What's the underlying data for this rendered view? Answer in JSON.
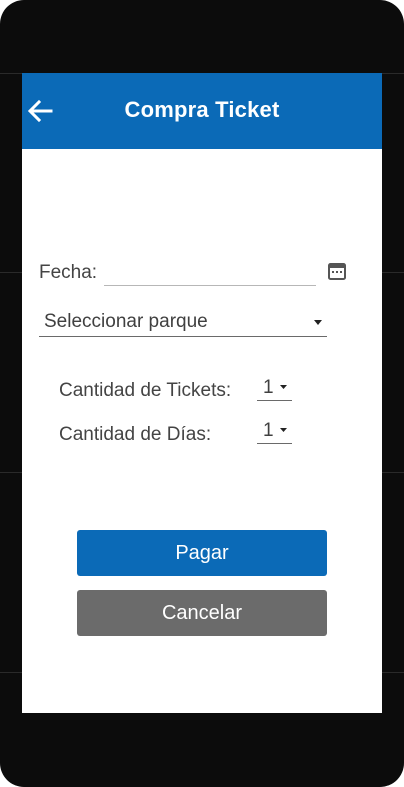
{
  "app_bar": {
    "title": "Compra Ticket",
    "back_icon": "arrow-back-icon",
    "background_color": "#0b6ab7"
  },
  "form": {
    "date_label": "Fecha:",
    "date_value": "",
    "calendar_icon": "calendar-icon",
    "park_select": {
      "selected": "Seleccionar parque"
    },
    "tickets": {
      "label": "Cantidad de Tickets:",
      "selected": "1"
    },
    "days": {
      "label": "Cantidad de Días:",
      "selected": "1"
    }
  },
  "actions": {
    "pay_label": "Pagar",
    "pay_color": "#0b6ab7",
    "cancel_label": "Cancelar",
    "cancel_color": "#6b6b6b"
  }
}
